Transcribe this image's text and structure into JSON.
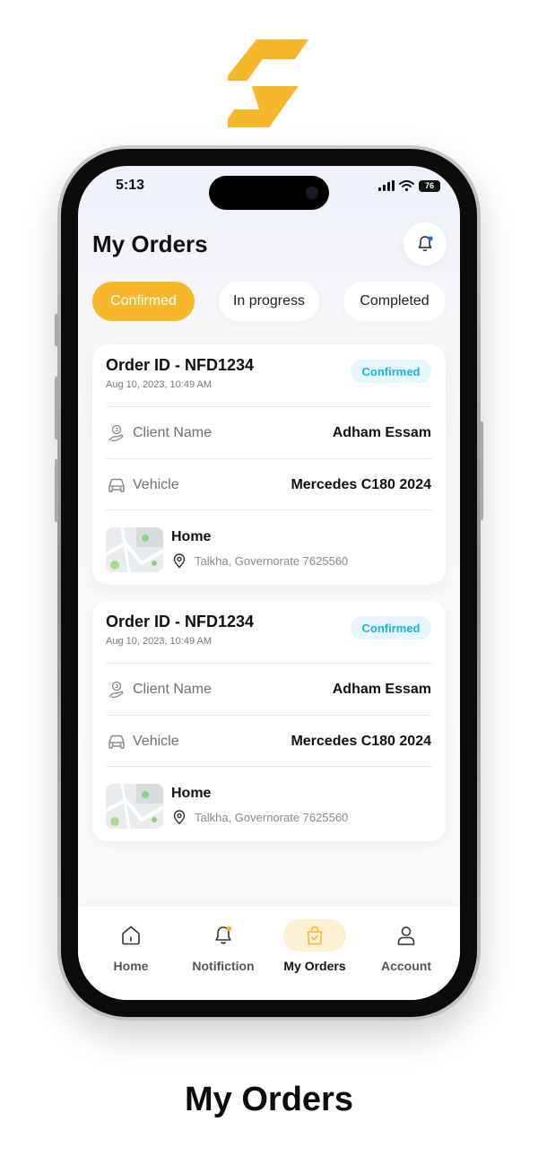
{
  "status_bar": {
    "time": "5:13",
    "battery": "76"
  },
  "header": {
    "title": "My Orders"
  },
  "tabs": [
    {
      "label": "Confirmed",
      "active": true
    },
    {
      "label": "In progress",
      "active": false
    },
    {
      "label": "Completed",
      "active": false
    }
  ],
  "orders": [
    {
      "order_id": "Order ID - NFD1234",
      "date": "Aug 10, 2023, 10:49 AM",
      "status": "Confirmed",
      "client_label": "Client Name",
      "client_value": "Adham Essam",
      "vehicle_label": "Vehicle",
      "vehicle_value": "Mercedes C180 2024",
      "address_title": "Home",
      "address_text": "Talkha, Governorate 7625560"
    },
    {
      "order_id": "Order ID - NFD1234",
      "date": "Aug 10, 2023, 10:49 AM",
      "status": "Confirmed",
      "client_label": "Client Name",
      "client_value": "Adham Essam",
      "vehicle_label": "Vehicle",
      "vehicle_value": "Mercedes C180 2024",
      "address_title": "Home",
      "address_text": "Talkha, Governorate 7625560"
    }
  ],
  "bottom_nav": [
    {
      "label": "Home",
      "icon": "home-icon",
      "active": false
    },
    {
      "label": "Notifiction",
      "icon": "bell-icon",
      "active": false
    },
    {
      "label": "My Orders",
      "icon": "shopping-bag-icon",
      "active": true
    },
    {
      "label": "Account",
      "icon": "user-icon",
      "active": false
    }
  ],
  "caption": "My Orders",
  "colors": {
    "accent": "#f6b82a",
    "status_text": "#17b5e0",
    "status_bg": "#e6f6fc"
  }
}
